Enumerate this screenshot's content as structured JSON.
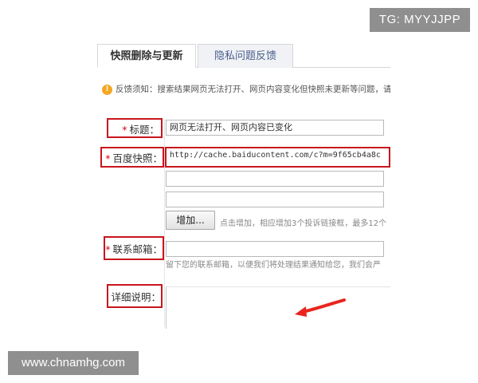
{
  "watermark_top": "TG: MYYJJPP",
  "watermark_bottom": "www.chnamhg.com",
  "tabs": [
    {
      "label": "快照删除与更新",
      "active": true
    },
    {
      "label": "隐私问题反馈",
      "active": false
    }
  ],
  "notice": {
    "icon": "warning-icon",
    "text": "反馈须知：搜索结果网页无法打开、网页内容变化但快照未更新等问题，请"
  },
  "form": {
    "required_mark": "*",
    "title_label": "标题：",
    "title_value": "网页无法打开、网页内容已变化",
    "snapshot_label": "百度快照：",
    "snapshot_value": "http://cache.baiducontent.com/c?m=9f65cb4a8c",
    "add_button": "增加...",
    "add_hint": "点击增加，相应增加3个投诉链接框，最多12个",
    "email_label": "联系邮箱：",
    "email_hint": "留下您的联系邮箱，以便我们将处理结果通知给您，我们会严",
    "detail_label": "详细说明："
  },
  "colors": {
    "highlight_box": "#c8161d",
    "required": "#d0021b",
    "arrow": "#e8251f"
  }
}
